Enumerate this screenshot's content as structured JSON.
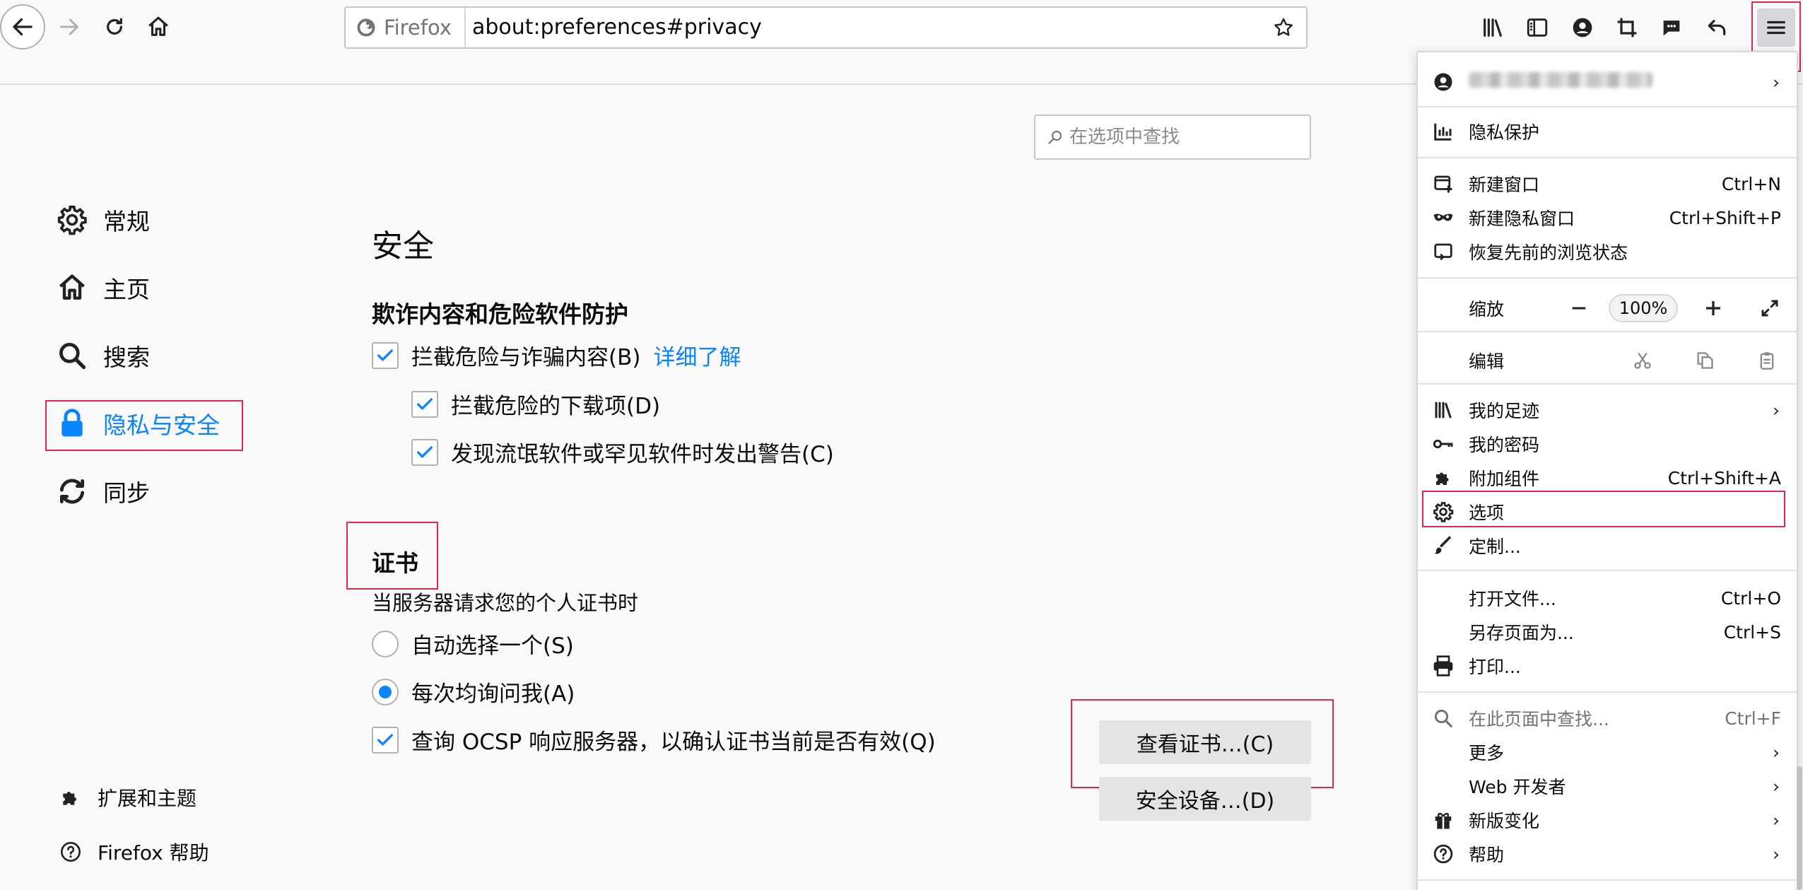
{
  "browser": {
    "identity_label": "Firefox",
    "url": "about:preferences#privacy"
  },
  "search": {
    "placeholder": "在选项中查找"
  },
  "sidebar": {
    "categories": [
      {
        "label": "常规",
        "icon": "gear-icon"
      },
      {
        "label": "主页",
        "icon": "home-icon"
      },
      {
        "label": "搜索",
        "icon": "search-icon"
      },
      {
        "label": "隐私与安全",
        "icon": "lock-icon",
        "selected": true
      },
      {
        "label": "同步",
        "icon": "sync-icon"
      }
    ],
    "footer": [
      {
        "label": "扩展和主题",
        "icon": "puzzle-icon"
      },
      {
        "label": "Firefox 帮助",
        "icon": "help-icon"
      }
    ]
  },
  "security": {
    "heading": "安全",
    "phishing_heading": "欺诈内容和危险软件防护",
    "block_dangerous": {
      "label": "拦截危险与诈骗内容(B)",
      "checked": true
    },
    "learn_more": "详细了解",
    "block_downloads": {
      "label": "拦截危险的下载项(D)",
      "checked": true
    },
    "warn_unwanted": {
      "label": "发现流氓软件或罕见软件时发出警告(C)",
      "checked": true
    }
  },
  "certificates": {
    "heading": "证书",
    "description": "当服务器请求您的个人证书时",
    "auto_select": {
      "label": "自动选择一个(S)",
      "selected": false
    },
    "ask_every_time": {
      "label": "每次均询问我(A)",
      "selected": true
    },
    "ocsp": {
      "label": "查询 OCSP 响应服务器，以确认证书当前是否有效(Q)",
      "checked": true
    },
    "view_certificates_button": "查看证书…(C)",
    "security_devices_button": "安全设备…(D)"
  },
  "app_menu": {
    "tracking_protection": "隐私保护",
    "new_window": {
      "label": "新建窗口",
      "shortcut": "Ctrl+N"
    },
    "new_private_window": {
      "label": "新建隐私窗口",
      "shortcut": "Ctrl+Shift+P"
    },
    "restore_session": "恢复先前的浏览状态",
    "zoom_label": "缩放",
    "zoom_level": "100%",
    "edit_label": "编辑",
    "library": "我的足迹",
    "logins": "我的密码",
    "addons": {
      "label": "附加组件",
      "shortcut": "Ctrl+Shift+A"
    },
    "preferences": "选项",
    "customize": "定制...",
    "open_file": {
      "label": "打开文件...",
      "shortcut": "Ctrl+O"
    },
    "save_page": {
      "label": "另存页面为...",
      "shortcut": "Ctrl+S"
    },
    "print": "打印...",
    "find": {
      "label": "在此页面中查找...",
      "shortcut": "Ctrl+F"
    },
    "more": "更多",
    "web_developer": "Web 开发者",
    "whats_new": "新版变化",
    "help": "帮助"
  },
  "colors": {
    "accent": "#0a84ff",
    "highlight_box": "#e22850",
    "background": "#f9f9fa"
  }
}
